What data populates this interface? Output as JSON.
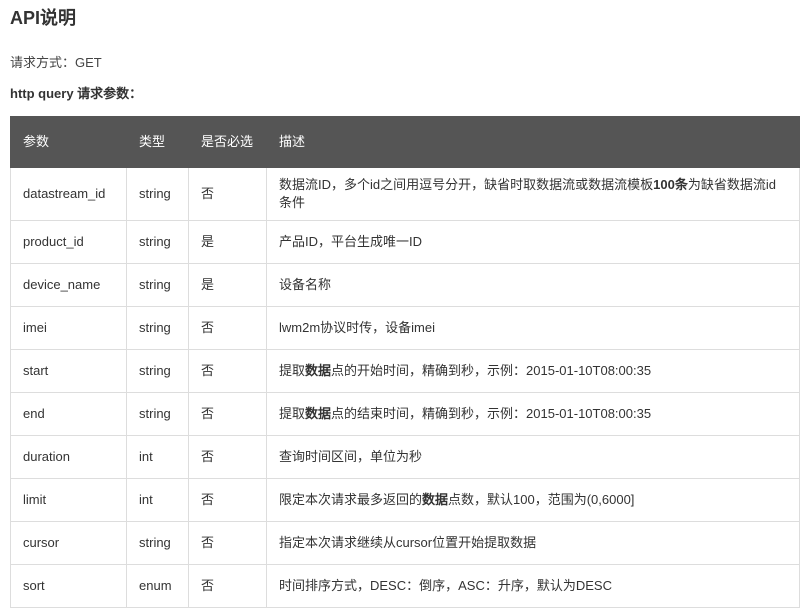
{
  "page": {
    "title": "API说明",
    "request_method": "请求方式：GET",
    "params_heading": "http query 请求参数："
  },
  "table": {
    "headers": {
      "param": "参数",
      "type": "类型",
      "required": "是否必选",
      "description": "描述"
    },
    "rows": [
      {
        "param": "datastream_id",
        "type": "string",
        "required": "否",
        "desc_parts": [
          "数据流ID，多个id之间用逗号分开，缺省时取数据流或数据流模板",
          "100条",
          "为缺省数据流id条件"
        ]
      },
      {
        "param": "product_id",
        "type": "string",
        "required": "是",
        "desc_parts": [
          "产品ID，平台生成唯一ID",
          "",
          ""
        ]
      },
      {
        "param": "device_name",
        "type": "string",
        "required": "是",
        "desc_parts": [
          "设备名称",
          "",
          ""
        ]
      },
      {
        "param": "imei",
        "type": "string",
        "required": "否",
        "desc_parts": [
          "lwm2m协议时传，设备imei",
          "",
          ""
        ]
      },
      {
        "param": "start",
        "type": "string",
        "required": "否",
        "desc_parts": [
          "提取",
          "数据",
          "点的开始时间，精确到秒，示例：2015-01-10T08:00:35"
        ]
      },
      {
        "param": "end",
        "type": "string",
        "required": "否",
        "desc_parts": [
          "提取",
          "数据",
          "点的结束时间，精确到秒，示例：2015-01-10T08:00:35"
        ]
      },
      {
        "param": "duration",
        "type": "int",
        "required": "否",
        "desc_parts": [
          "查询时间区间，单位为秒",
          "",
          ""
        ]
      },
      {
        "param": "limit",
        "type": "int",
        "required": "否",
        "desc_parts": [
          "限定本次请求最多返回的",
          "数据",
          "点数，默认100，范围为(0,6000]"
        ]
      },
      {
        "param": "cursor",
        "type": "string",
        "required": "否",
        "desc_parts": [
          "指定本次请求继续从cursor位置开始提取数据",
          "",
          ""
        ]
      },
      {
        "param": "sort",
        "type": "enum",
        "required": "否",
        "desc_parts": [
          "时间排序方式，DESC：倒序，ASC：升序，默认为DESC",
          "",
          ""
        ]
      }
    ]
  }
}
